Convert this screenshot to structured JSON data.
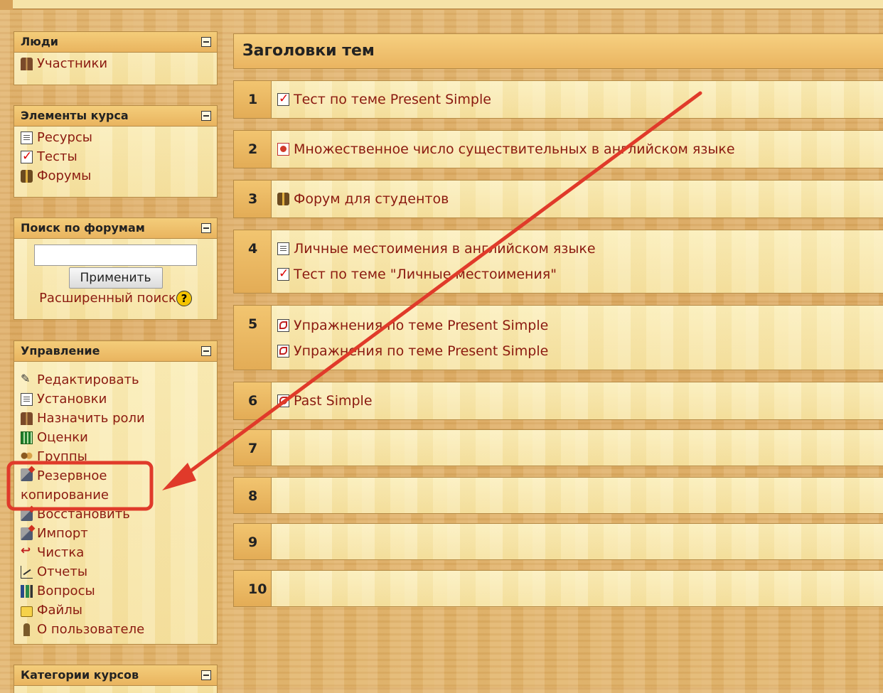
{
  "blocks": {
    "people": {
      "title": "Люди",
      "items": [
        {
          "label": "Участники",
          "icon": "participants-icon"
        }
      ]
    },
    "course_elements": {
      "title": "Элементы курса",
      "items": [
        {
          "label": "Ресурсы",
          "icon": "resource-page-icon"
        },
        {
          "label": "Тесты",
          "icon": "quiz-check-icon"
        },
        {
          "label": "Форумы",
          "icon": "forum-icon"
        }
      ]
    },
    "forum_search": {
      "title": "Поиск по форумам",
      "input_value": "",
      "apply_label": "Применить",
      "advanced_label": "Расширенный поиск",
      "help_glyph": "?"
    },
    "management": {
      "title": "Управление",
      "items": [
        {
          "label": "Редактировать",
          "icon": "edit-icon"
        },
        {
          "label": "Установки",
          "icon": "settings-icon"
        },
        {
          "label": "Назначить роли",
          "icon": "assign-roles-icon"
        },
        {
          "label": "Оценки",
          "icon": "grades-icon"
        },
        {
          "label": "Группы",
          "icon": "groups-icon"
        },
        {
          "label": "Резервное копирование",
          "icon": "backup-icon"
        },
        {
          "label": "Восстановить",
          "icon": "restore-icon"
        },
        {
          "label": "Импорт",
          "icon": "import-icon"
        },
        {
          "label": "Чистка",
          "icon": "reset-icon"
        },
        {
          "label": "Отчеты",
          "icon": "reports-icon"
        },
        {
          "label": "Вопросы",
          "icon": "questions-icon"
        },
        {
          "label": "Файлы",
          "icon": "folder-icon"
        },
        {
          "label": "О пользователе",
          "icon": "user-profile-icon"
        }
      ]
    },
    "course_categories": {
      "title": "Категории курсов"
    }
  },
  "main": {
    "title": "Заголовки тем",
    "topics": [
      {
        "num": "1",
        "items": [
          {
            "label": "Тест по теме Present Simple",
            "icon": "quiz-check-icon"
          }
        ]
      },
      {
        "num": "2",
        "items": [
          {
            "label": "Множественное число существительных в английском языке",
            "icon": "presentation-icon"
          }
        ]
      },
      {
        "num": "3",
        "items": [
          {
            "label": "Форум для студентов",
            "icon": "forum-icon"
          }
        ]
      },
      {
        "num": "4",
        "items": [
          {
            "label": "Личные местоимения в английском языке",
            "icon": "resource-page-icon"
          },
          {
            "label": "Тест по теме \"Личные местоимения\"",
            "icon": "quiz-check-icon"
          }
        ]
      },
      {
        "num": "5",
        "items": [
          {
            "label": "Упражнения по теме Present Simple",
            "icon": "pdf-icon"
          },
          {
            "label": "Упражнения по теме Present Simple",
            "icon": "pdf-icon"
          }
        ]
      },
      {
        "num": "6",
        "items": [
          {
            "label": "Past Simple",
            "icon": "pdf-icon"
          }
        ]
      },
      {
        "num": "7",
        "items": []
      },
      {
        "num": "8",
        "items": []
      },
      {
        "num": "9",
        "items": []
      },
      {
        "num": "10",
        "items": []
      }
    ]
  },
  "annotation": {
    "highlight_color": "#e03a2a",
    "target": "Резервное копирование"
  }
}
